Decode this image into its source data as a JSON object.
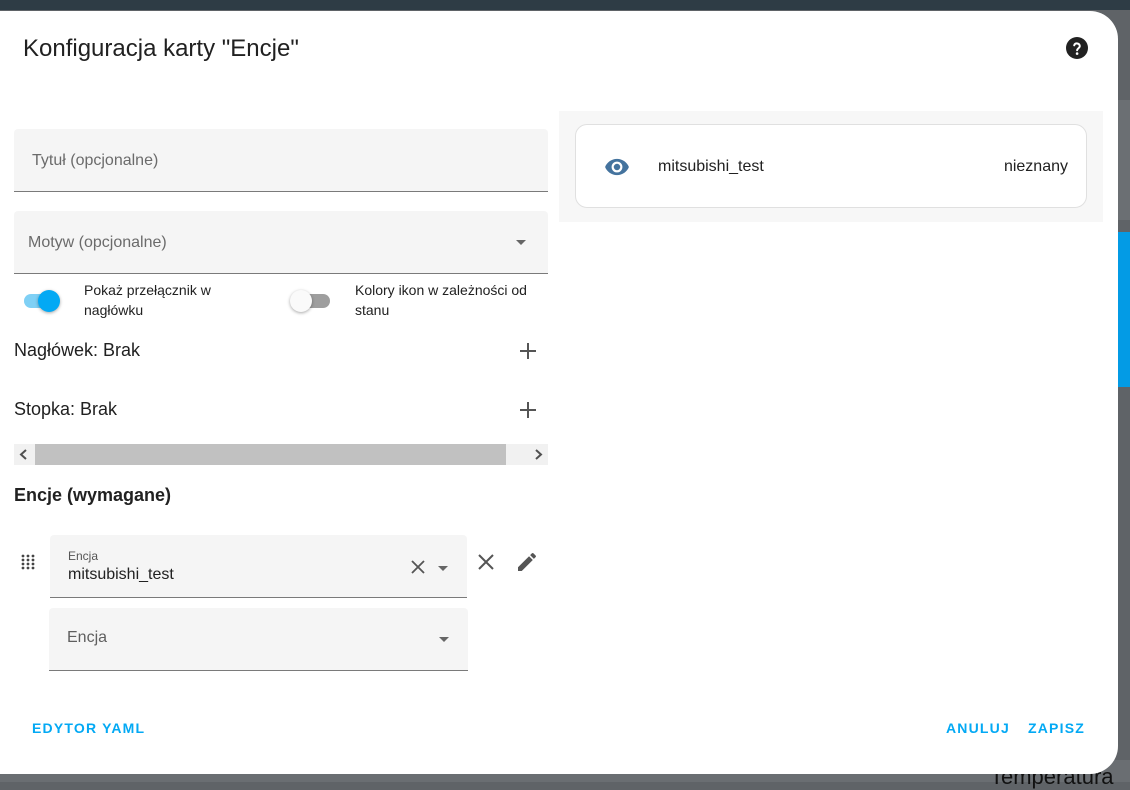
{
  "background": {
    "bottom_text": "Temperatura"
  },
  "dialog": {
    "title": "Konfiguracja karty \"Encje\"",
    "help_icon": "help-circle-icon"
  },
  "editor": {
    "title_placeholder": "Tytuł (opcjonalne)",
    "theme_placeholder": "Motyw (opcjonalne)",
    "toggles": [
      {
        "label": "Pokaż przełącznik w nagłówku",
        "on": true
      },
      {
        "label": "Kolory ikon w zależności od stanu",
        "on": false
      }
    ],
    "header_label": "Nagłówek: Brak",
    "footer_label": "Stopka: Brak",
    "entities_title": "Encje (wymagane)",
    "entity_row": {
      "label": "Encja",
      "value": "mitsubishi_test"
    },
    "new_entity_placeholder": "Encja"
  },
  "preview": {
    "entity_name": "mitsubishi_test",
    "entity_state": "nieznany",
    "icon": "eye-icon"
  },
  "actions": {
    "yaml": "EDYTOR YAML",
    "cancel": "ANULUJ",
    "save": "ZAPISZ"
  },
  "colors": {
    "accent": "#03a9f4",
    "icon_blue": "#44739e"
  }
}
